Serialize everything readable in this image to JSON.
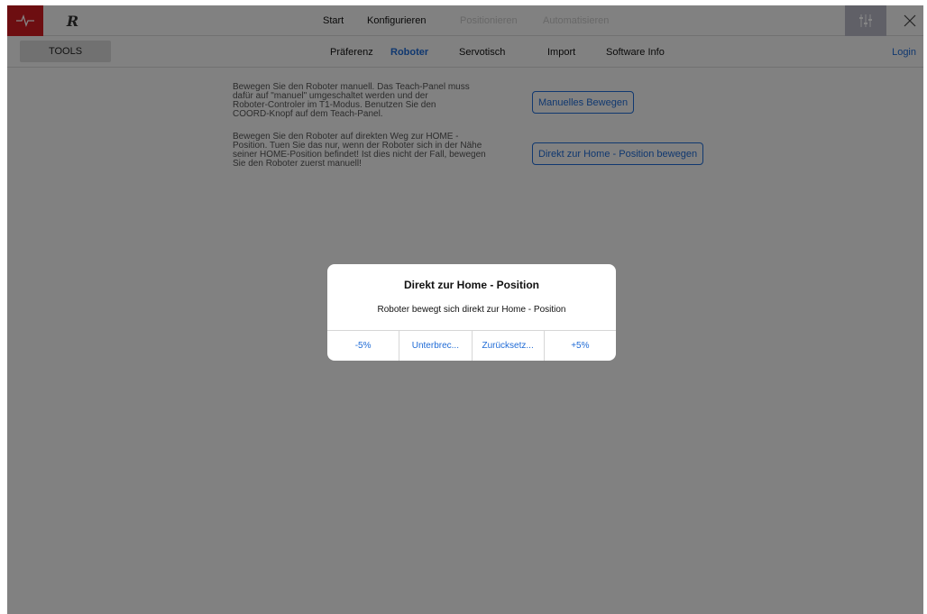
{
  "topbar": {
    "logo_text": "R",
    "nav": [
      {
        "label": "Start",
        "enabled": true
      },
      {
        "label": "Konfigurieren",
        "enabled": true
      },
      {
        "label": "Positionieren",
        "enabled": false
      },
      {
        "label": "Automatisieren",
        "enabled": false
      }
    ],
    "icons": {
      "left": "heartbeat-icon",
      "logo": "robot-logo-icon",
      "mixer": "sliders-icon",
      "close": "close-icon"
    },
    "accent_red": "#d21b22"
  },
  "subbar": {
    "tools_label": "TOOLS",
    "tabs": [
      {
        "label": "Präferenz"
      },
      {
        "label": "Roboter",
        "selected": true
      },
      {
        "label": "Servotisch"
      },
      {
        "label": "Import"
      },
      {
        "label": "Software Info"
      }
    ],
    "login_label": "Login",
    "accent_blue": "#1f6bd6"
  },
  "content": {
    "manual": {
      "lines": [
        "Bewegen Sie den Roboter manuell.  Das Teach-Panel muss",
        "dafür auf \"manuel\" umgeschaltet werden und der",
        "Roboter-Controler im T1-Modus. Benutzen Sie den",
        "COORD-Knopf auf dem Teach-Panel."
      ],
      "button_label": "Manuelles Bewegen"
    },
    "home": {
      "lines": [
        "Bewegen Sie den Roboter auf direkten Weg zur HOME -",
        "Position. Tuen Sie das nur, wenn der Roboter sich in der Nähe",
        "seiner HOME-Position befindet! Ist dies nicht der Fall, bewegen",
        "Sie den Roboter zuerst manuell!"
      ],
      "button_label": "Direkt zur Home - Position bewegen"
    }
  },
  "dialog": {
    "title": "Direkt zur Home - Position",
    "message": "Roboter bewegt sich direkt zur Home - Position",
    "buttons": [
      "-5%",
      "Unterbrec...",
      "Zurücksetz...",
      "+5%"
    ]
  }
}
